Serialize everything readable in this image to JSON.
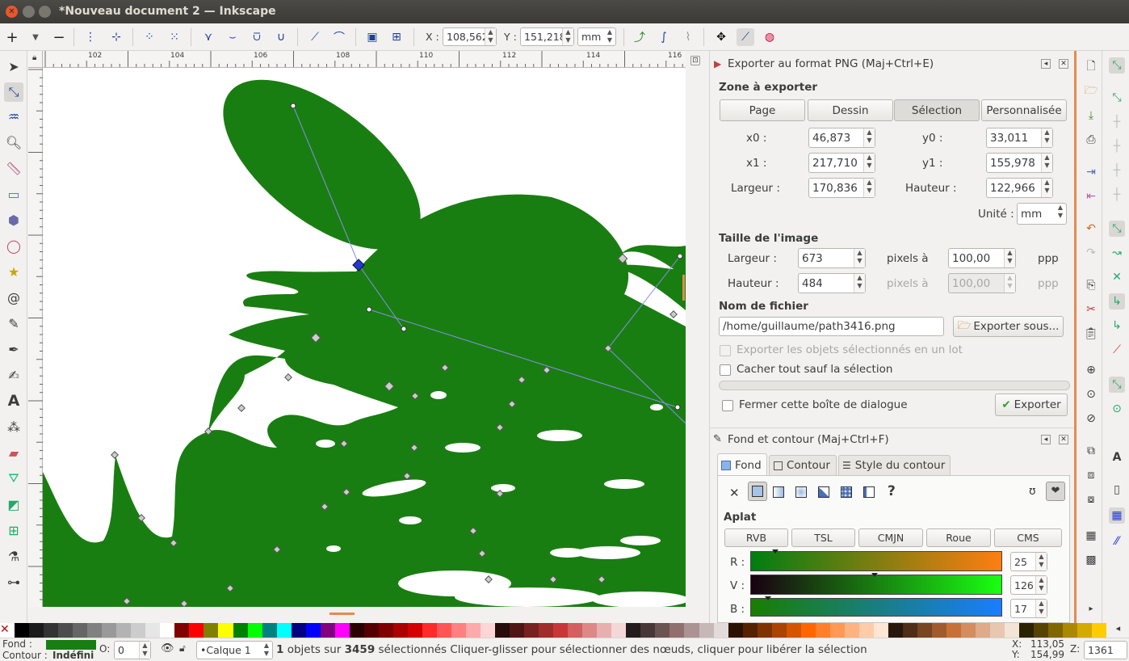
{
  "window": {
    "title": "*Nouveau document 2 — Inkscape"
  },
  "controls": {
    "x_label": "X :",
    "x_value": "108,562",
    "y_label": "Y :",
    "y_value": "151,218",
    "unit": "mm"
  },
  "ruler": {
    "labels": [
      "102",
      "104",
      "106",
      "108",
      "110",
      "112",
      "114",
      "116"
    ]
  },
  "export": {
    "title": "Exporter au format PNG (Maj+Ctrl+E)",
    "zone_title": "Zone à exporter",
    "zone_buttons": [
      "Page",
      "Dessin",
      "Sélection",
      "Personnalisée"
    ],
    "x0_label": "x0 :",
    "x0": "46,873",
    "y0_label": "y0 :",
    "y0": "33,011",
    "x1_label": "x1 :",
    "x1": "217,710",
    "y1_label": "y1 :",
    "y1": "155,978",
    "width_label": "Largeur :",
    "width": "170,836",
    "height_label": "Hauteur :",
    "height": "122,966",
    "unit_label": "Unité :",
    "unit": "mm",
    "image_title": "Taille de l'image",
    "img_width_label": "Largeur :",
    "img_width": "673",
    "img_height_label": "Hauteur :",
    "img_height": "484",
    "pixels_at": "pixels à",
    "dpi1": "100,00",
    "dpi2": "100,00",
    "ppp": "ppp",
    "filename_title": "Nom de fichier",
    "filename": "/home/guillaume/path3416.png",
    "export_as": "Exporter sous...",
    "batch": "Exporter les objets sélectionnés en un lot",
    "hide_all": "Cacher tout sauf la sélection",
    "close_dialog": "Fermer cette boîte de dialogue",
    "export_btn": "Exporter"
  },
  "fill": {
    "title": "Fond et contour (Maj+Ctrl+F)",
    "tabs": [
      "Fond",
      "Contour",
      "Style du contour"
    ],
    "type_label": "Aplat",
    "modes": [
      "RVB",
      "TSL",
      "CMJN",
      "Roue",
      "CMS"
    ],
    "r_label": "R :",
    "r": "25",
    "v_label": "V :",
    "v": "126",
    "b_label": "B :",
    "b": "17",
    "color": "#197e11"
  },
  "status": {
    "fond_label": "Fond :",
    "contour_label": "Contour :",
    "contour_value": "Indéfini",
    "o_label": "O:",
    "o_value": "0",
    "layer": "•Calque 1",
    "msg_count": "1",
    "msg_mid": " objets sur ",
    "msg_total": "3459",
    "msg_rest": " sélectionnés Cliquer-glisser pour sélectionner des nœuds, cliquer pour libérer la sélection",
    "coord_x_label": "X:",
    "coord_x": "113,05",
    "coord_y_label": "Y:",
    "coord_y": "154,99",
    "zoom_label": "Z:",
    "zoom": "1361"
  }
}
